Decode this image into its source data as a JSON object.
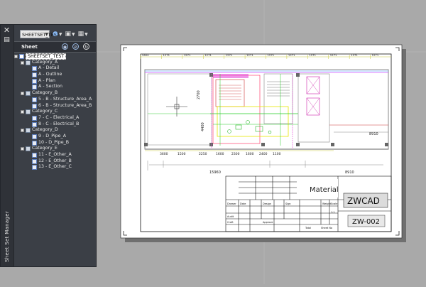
{
  "panel": {
    "title": "Sheet Set Manager",
    "strip_icons": [
      "close-icon",
      "settings-icon"
    ],
    "toolbar": {
      "sheetset_label": "SHEETSET_TEST",
      "buttons": [
        "globe-icon",
        "sheet-action-icon",
        "properties-icon"
      ]
    },
    "sheet_header": {
      "label": "Sheet",
      "icons": [
        "view-icon",
        "hide-icon",
        "refresh-icon"
      ]
    },
    "tree": [
      {
        "level": 0,
        "type": "root",
        "label": "SHEETSET_TEST",
        "expanded": true
      },
      {
        "level": 1,
        "type": "folder",
        "label": "Category_A",
        "expanded": true
      },
      {
        "level": 2,
        "type": "sheet",
        "label": "A - Detail"
      },
      {
        "level": 2,
        "type": "sheet",
        "label": "A - Outline"
      },
      {
        "level": 2,
        "type": "sheet",
        "label": "A - Plan"
      },
      {
        "level": 2,
        "type": "sheet",
        "label": "A - Section"
      },
      {
        "level": 1,
        "type": "folder",
        "label": "Category_B",
        "expanded": true
      },
      {
        "level": 2,
        "type": "sheet",
        "label": "5 - B - Structure_Area_A"
      },
      {
        "level": 2,
        "type": "sheet",
        "label": "6 - B - Structure_Area_B"
      },
      {
        "level": 1,
        "type": "folder",
        "label": "Category_C",
        "expanded": true
      },
      {
        "level": 2,
        "type": "sheet",
        "label": "7 - C - Electrical_A"
      },
      {
        "level": 2,
        "type": "sheet",
        "label": "8 - C - Electrical_B"
      },
      {
        "level": 1,
        "type": "folder",
        "label": "Category_D",
        "expanded": true
      },
      {
        "level": 2,
        "type": "sheet",
        "label": "9 - D_Pipe_A"
      },
      {
        "level": 2,
        "type": "sheet",
        "label": "10 - D_Pipe_B"
      },
      {
        "level": 1,
        "type": "folder",
        "label": "Category_E",
        "expanded": true
      },
      {
        "level": 2,
        "type": "sheet",
        "label": "11 - E_Other_A"
      },
      {
        "level": 2,
        "type": "sheet",
        "label": "12 - E_Other_B"
      },
      {
        "level": 2,
        "type": "sheet",
        "label": "13 - E_Other_C"
      }
    ]
  },
  "drawing": {
    "title_block": {
      "material_label": "Material",
      "company": "ZWCAD",
      "drawing_no": "ZW-002",
      "row_labels": [
        "Drawer",
        "Date",
        "Audit",
        "Craft"
      ],
      "mid_labels": [
        "Design",
        "Sign",
        "Approve"
      ],
      "right_labels": [
        "Weight",
        "Scale",
        "Total",
        "Sheet No"
      ],
      "scale_value": "1:1"
    },
    "dimensions": {
      "top_row": [
        "2600",
        "1271",
        "1271",
        "1271",
        "1271",
        "1271",
        "1271",
        "1271",
        "1271",
        "1271",
        "1271",
        "1271"
      ],
      "mid_row": [
        "3600",
        "1500",
        "2250",
        "1600",
        "2300",
        "1600",
        "2400",
        "1100"
      ],
      "bottom_main": "15960",
      "bottom_right": "8910",
      "right_mid": "8910",
      "vert": [
        "2700",
        "4400"
      ]
    }
  }
}
